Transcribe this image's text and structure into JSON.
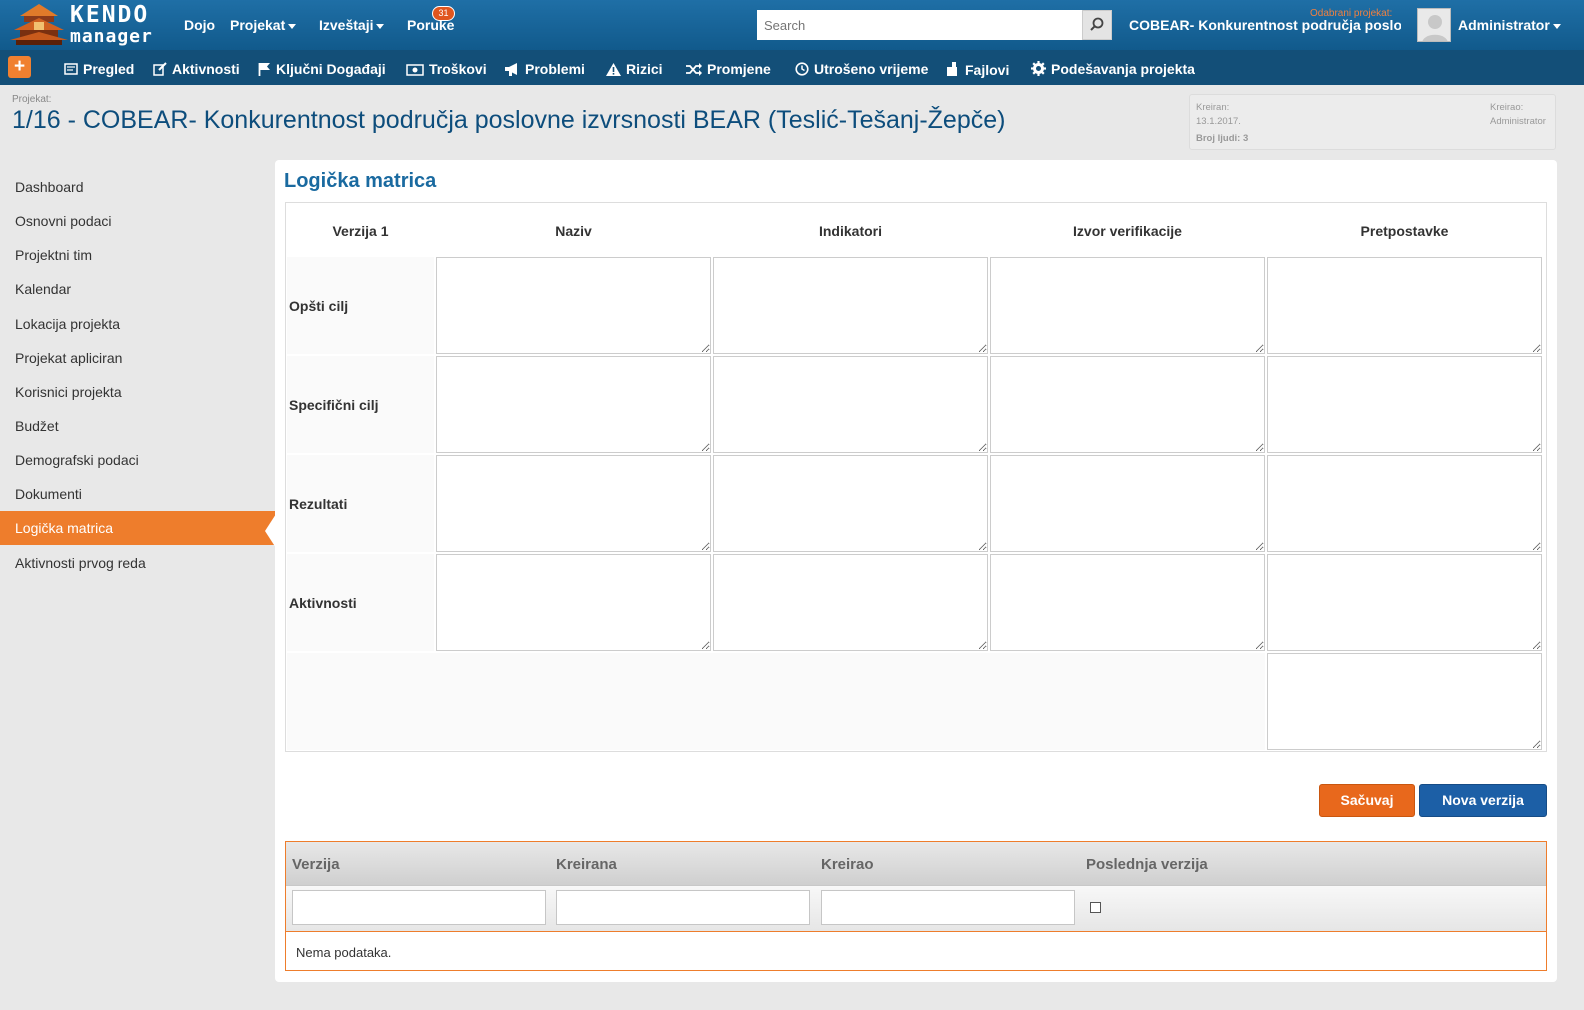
{
  "app": {
    "logo_top": "KENDO",
    "logo_bottom": "manager"
  },
  "topnav": {
    "dojo": "Dojo",
    "projekat": "Projekat",
    "izvestaji": "Izveštaji",
    "poruke": "Poruke",
    "poruke_badge": "31",
    "search_placeholder": "Search",
    "selected_label": "Odabrani projekat:",
    "selected_project": "COBEAR- Konkurentnost područja poslovne",
    "user": "Administrator"
  },
  "toolbar": {
    "plus": "+",
    "items": [
      "Pregled",
      "Aktivnosti",
      "Ključni Događaji",
      "Troškovi",
      "Problemi",
      "Rizici",
      "Promjene",
      "Utrošeno vrijeme",
      "Fajlovi",
      "Podešavanja projekta"
    ]
  },
  "project": {
    "label": "Projekat:",
    "title": "1/16 - COBEAR- Konkurentnost područja poslovne izvrsnosti BEAR (Teslić-Tešanj-Žepče)",
    "kreiran_label": "Kreiran:",
    "kreiran_value": "13.1.2017.",
    "kreirao_label": "Kreirao:",
    "kreirao_value": "Administrator",
    "broj_ljudi": "Broj ljudi: 3"
  },
  "sidebar": {
    "items": [
      "Dashboard",
      "Osnovni podaci",
      "Projektni tim",
      "Kalendar",
      "Lokacija projekta",
      "Projekat apliciran",
      "Korisnici projekta",
      "Budžet",
      "Demografski podaci",
      "Dokumenti",
      "Logička matrica",
      "Aktivnosti prvog reda"
    ],
    "active": "Logička matrica"
  },
  "main": {
    "title": "Logička matrica",
    "matrix": {
      "version": "Verzija 1",
      "columns": [
        "Naziv",
        "Indikatori",
        "Izvor verifikacije",
        "Pretpostavke"
      ],
      "rows": [
        "Opšti cilj",
        "Specifični cilj",
        "Rezultati",
        "Aktivnosti"
      ]
    },
    "buttons": {
      "save": "Sačuvaj",
      "new_version": "Nova verzija"
    },
    "grid": {
      "columns": [
        "Verzija",
        "Kreirana",
        "Kreirao",
        "Poslednja verzija"
      ],
      "empty": "Nema podataka."
    }
  },
  "colors": {
    "accent_orange": "#ee7d2c",
    "brand_blue": "#115a8c",
    "title_blue": "#0d4d7c"
  }
}
